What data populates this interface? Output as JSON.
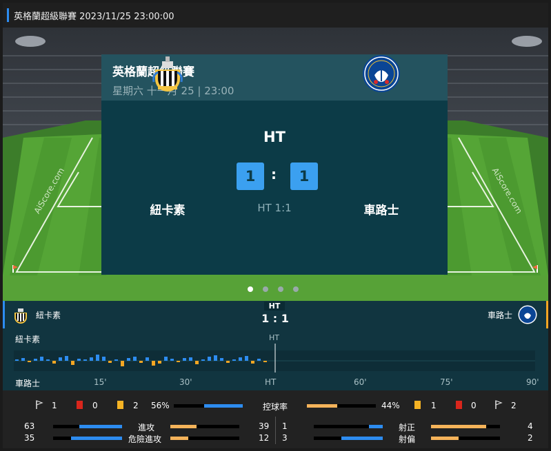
{
  "header": {
    "title": "英格蘭超級聯賽 2023/11/25 23:00:00"
  },
  "match": {
    "league": "英格蘭超級聯賽",
    "date": "星期六 十一月 25 | 23:00",
    "status": "HT",
    "home_team": "紐卡素",
    "away_team": "車路士",
    "home_score": "1",
    "away_score": "1",
    "colon": ":",
    "halftime": "HT 1:1",
    "watermark": "AiScore.com"
  },
  "carousel": {
    "count": 4,
    "active": 0
  },
  "timeline": {
    "status": "HT",
    "score": "1 : 1",
    "home_team": "紐卡素",
    "away_team": "車路士",
    "ht_marker": "HT",
    "ticks": [
      "15'",
      "30'",
      "HT",
      "60'",
      "75'",
      "90'"
    ],
    "home_color": "#2d8cf0",
    "away_color": "#f5a623"
  },
  "stats": {
    "home_corners": "1",
    "home_red": "0",
    "home_yellow": "2",
    "possession_home": "56%",
    "possession_label": "控球率",
    "possession_away": "44%",
    "away_yellow": "1",
    "away_red": "0",
    "away_corners": "2",
    "attacks_home": "63",
    "attacks_label": "進攻",
    "attacks_away": "39",
    "dangerous_home": "35",
    "dangerous_label": "危險進攻",
    "dangerous_away": "12",
    "on_target_home": "1",
    "on_target_label": "射正",
    "on_target_away": "4",
    "off_target_home": "3",
    "off_target_label": "射偏",
    "off_target_away": "2"
  }
}
